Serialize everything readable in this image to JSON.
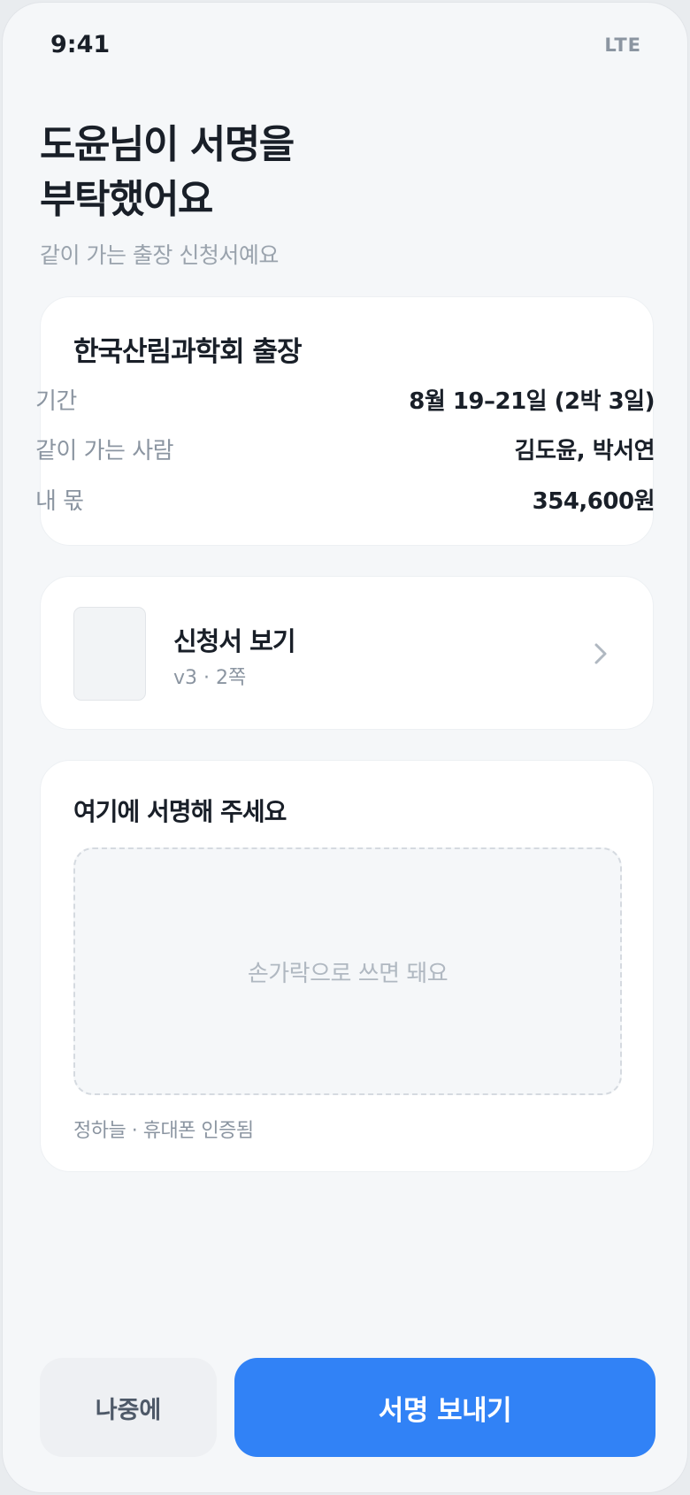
{
  "status_bar": {
    "time": "9:41",
    "network": "LTE"
  },
  "header": {
    "title_line1": "도윤님이 서명을",
    "title_line2": "부탁했어요",
    "subtitle": "같이 가는 출장 신청서예요"
  },
  "trip": {
    "title": "한국산림과학회 출장",
    "rows": [
      {
        "label": "기간",
        "value": "8월 19–21일 (2박 3일)"
      },
      {
        "label": "같이 가는 사람",
        "value": "김도윤, 박서연"
      },
      {
        "label": "내 몫",
        "value": "354,600원"
      }
    ]
  },
  "document": {
    "title": "신청서 보기",
    "meta": "v3 · 2쪽",
    "icon": "chevron-right-icon"
  },
  "signature": {
    "title": "여기에 서명해 주세요",
    "placeholder": "손가락으로 쓰면 돼요",
    "note": "정하늘 · 휴대폰 인증됨"
  },
  "actions": {
    "later_label": "나중에",
    "send_label": "서명 보내기"
  },
  "colors": {
    "accent": "#3182f6",
    "background": "#f5f7f9",
    "text_primary": "#191f28",
    "text_secondary": "#8b95a1"
  }
}
